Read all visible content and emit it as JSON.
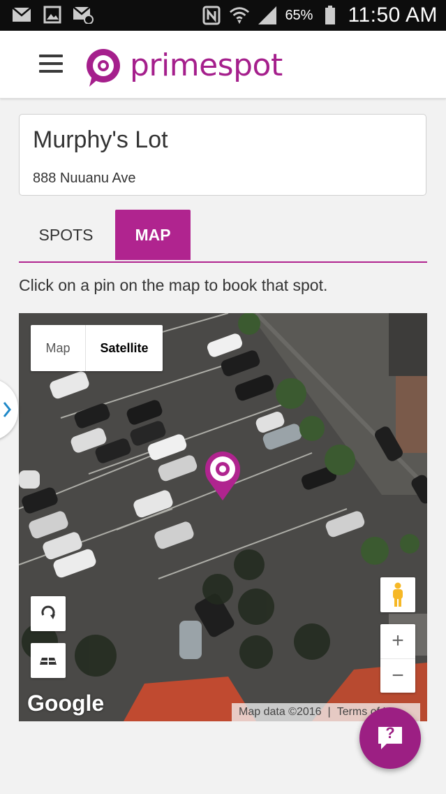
{
  "status_bar": {
    "battery": "65%",
    "time": "11:50 AM"
  },
  "header": {
    "app_name": "primespot",
    "brand_color": "#a51f8c"
  },
  "location": {
    "name": "Murphy's Lot",
    "address": "888 Nuuanu Ave"
  },
  "tabs": [
    {
      "label": "SPOTS",
      "active": false
    },
    {
      "label": "MAP",
      "active": true
    }
  ],
  "instruction": "Click on a pin on the map to book that spot.",
  "map": {
    "type_options": [
      {
        "label": "Map",
        "selected": false
      },
      {
        "label": "Satellite",
        "selected": true
      }
    ],
    "zoom_in": "+",
    "zoom_out": "−",
    "provider": "Google",
    "attribution": "Map data ©2016",
    "terms": "Terms of Use"
  },
  "help_button": {
    "label": "?"
  }
}
